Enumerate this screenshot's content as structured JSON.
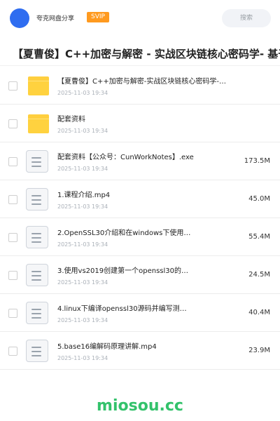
{
  "header": {
    "app_name": "夸克网盘分享",
    "badge": "SVIP",
    "search_placeholder": "搜索"
  },
  "folder_title": "【夏曹俊】C++加密与解密 - 实战区块链核心密码学- 基于o",
  "files": [
    {
      "type": "folder",
      "name": "【夏曹俊】C++加密与解密-实战区块链核心密码学-…",
      "date": "2025-11-03 19:34",
      "size": ""
    },
    {
      "type": "folder",
      "name": "配套资料",
      "date": "2025-11-03 19:34",
      "size": ""
    },
    {
      "type": "file",
      "name": "配套资料【公众号：CunWorkNotes】.exe",
      "date": "2025-11-03 19:34",
      "size": "173.5M"
    },
    {
      "type": "file",
      "name": "1.课程介绍.mp4",
      "date": "2025-11-03 19:34",
      "size": "45.0M"
    },
    {
      "type": "file",
      "name": "2.OpenSSL30介绍和在windows下使用…",
      "date": "2025-11-03 19:34",
      "size": "55.4M"
    },
    {
      "type": "file",
      "name": "3.使用vs2019创建第一个openssl30的…",
      "date": "2025-11-03 19:34",
      "size": "24.5M"
    },
    {
      "type": "file",
      "name": "4.linux下编译openssl30源码并编写测…",
      "date": "2025-11-03 19:34",
      "size": "40.4M"
    },
    {
      "type": "file",
      "name": "5.base16编解码原理讲解.mp4",
      "date": "2025-11-03 19:34",
      "size": "23.9M"
    }
  ],
  "watermark": "miosou.cc",
  "colors": {
    "accent": "#2f6df0",
    "svip": "#ff9a1f",
    "folder": "#ffd23f",
    "watermark": "#33c26b"
  }
}
